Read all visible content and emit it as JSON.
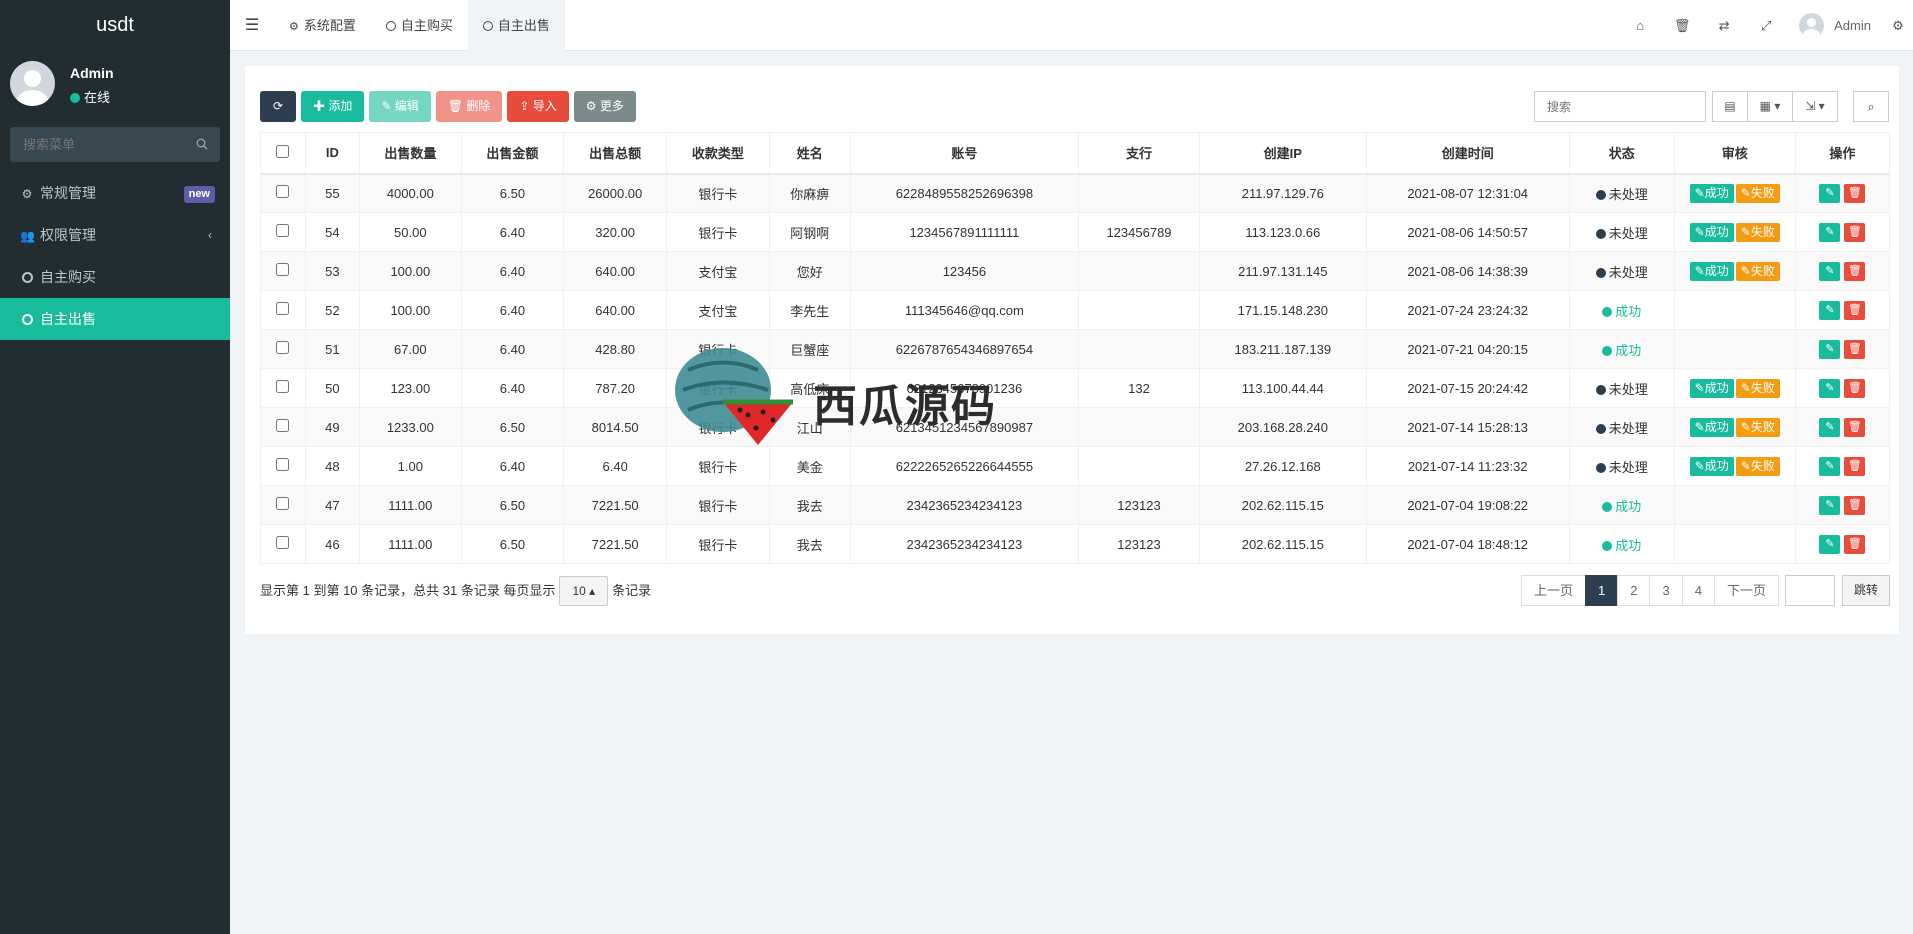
{
  "app": {
    "logo": "usdt"
  },
  "sidebar": {
    "user": {
      "name": "Admin",
      "status": "在线"
    },
    "search_placeholder": "搜索菜单",
    "items": [
      {
        "label": "常规管理",
        "icon": "cogs-icon",
        "badge": "new"
      },
      {
        "label": "权限管理",
        "icon": "users-icon",
        "chevron": "‹"
      },
      {
        "label": "自主购买",
        "icon": "circle-o-icon"
      },
      {
        "label": "自主出售",
        "icon": "circle-o-icon",
        "active": true
      }
    ]
  },
  "header": {
    "tabs": [
      {
        "label": "系统配置"
      },
      {
        "label": "自主购买"
      },
      {
        "label": "自主出售",
        "active": true
      }
    ],
    "user_name": "Admin"
  },
  "toolbar": {
    "add": "添加",
    "edit": "编辑",
    "delete": "删除",
    "import": "导入",
    "more": "更多",
    "search_placeholder": "搜索"
  },
  "table": {
    "columns": [
      "ID",
      "出售数量",
      "出售金额",
      "出售总额",
      "收款类型",
      "姓名",
      "账号",
      "支行",
      "创建IP",
      "创建时间",
      "状态",
      "审核",
      "操作"
    ],
    "rows": [
      {
        "id": "55",
        "qty": "4000.00",
        "price": "6.50",
        "total": "26000.00",
        "type": "银行卡",
        "name": "你麻痹",
        "account": "6228489558252696398",
        "branch": "",
        "ip": "211.97.129.76",
        "time": "2021-08-07 12:31:04",
        "status": "未处理",
        "pending": true
      },
      {
        "id": "54",
        "qty": "50.00",
        "price": "6.40",
        "total": "320.00",
        "type": "银行卡",
        "name": "阿钢啊",
        "account": "1234567891111111",
        "branch": "123456789",
        "ip": "113.123.0.66",
        "time": "2021-08-06 14:50:57",
        "status": "未处理",
        "pending": true
      },
      {
        "id": "53",
        "qty": "100.00",
        "price": "6.40",
        "total": "640.00",
        "type": "支付宝",
        "name": "您好",
        "account": "123456",
        "branch": "",
        "ip": "211.97.131.145",
        "time": "2021-08-06 14:38:39",
        "status": "未处理",
        "pending": true
      },
      {
        "id": "52",
        "qty": "100.00",
        "price": "6.40",
        "total": "640.00",
        "type": "支付宝",
        "name": "李先生",
        "account": "111345646@qq.com",
        "branch": "",
        "ip": "171.15.148.230",
        "time": "2021-07-24 23:24:32",
        "status": "成功",
        "pending": false
      },
      {
        "id": "51",
        "qty": "67.00",
        "price": "6.40",
        "total": "428.80",
        "type": "银行卡",
        "name": "巨蟹座",
        "account": "6226787654346897654",
        "branch": "",
        "ip": "183.211.187.139",
        "time": "2021-07-21 04:20:15",
        "status": "成功",
        "pending": false
      },
      {
        "id": "50",
        "qty": "123.00",
        "price": "6.40",
        "total": "787.20",
        "type": "银行卡",
        "name": "高低床",
        "account": "6212345678901236",
        "branch": "132",
        "ip": "113.100.44.44",
        "time": "2021-07-15 20:24:42",
        "status": "未处理",
        "pending": true
      },
      {
        "id": "49",
        "qty": "1233.00",
        "price": "6.50",
        "total": "8014.50",
        "type": "银行卡",
        "name": "江山",
        "account": "6213451234567890987",
        "branch": "",
        "ip": "203.168.28.240",
        "time": "2021-07-14 15:28:13",
        "status": "未处理",
        "pending": true
      },
      {
        "id": "48",
        "qty": "1.00",
        "price": "6.40",
        "total": "6.40",
        "type": "银行卡",
        "name": "美金",
        "account": "6222265265226644555",
        "branch": "",
        "ip": "27.26.12.168",
        "time": "2021-07-14 11:23:32",
        "status": "未处理",
        "pending": true
      },
      {
        "id": "47",
        "qty": "1111.00",
        "price": "6.50",
        "total": "7221.50",
        "type": "银行卡",
        "name": "我去",
        "account": "2342365234234123",
        "branch": "123123",
        "ip": "202.62.115.15",
        "time": "2021-07-04 19:08:22",
        "status": "成功",
        "pending": false
      },
      {
        "id": "46",
        "qty": "1111.00",
        "price": "6.50",
        "total": "7221.50",
        "type": "银行卡",
        "name": "我去",
        "account": "2342365234234123",
        "branch": "123123",
        "ip": "202.62.115.15",
        "time": "2021-07-04 18:48:12",
        "status": "成功",
        "pending": false
      }
    ],
    "audit_success": "成功",
    "audit_fail": "失败"
  },
  "pagination": {
    "info_prefix": "显示第 1 到第 10 条记录，总共 31 条记录 每页显示",
    "page_size": "10",
    "info_suffix": "条记录",
    "prev": "上一页",
    "pages": [
      "1",
      "2",
      "3",
      "4"
    ],
    "current": "1",
    "next": "下一页",
    "goto": "跳转"
  },
  "watermark": {
    "text": "西瓜源码"
  },
  "colors": {
    "primary": "#18bc9c",
    "dark": "#2c3e50",
    "danger": "#e74c3c",
    "warning": "#f39c12",
    "sidebar": "#222d32"
  }
}
